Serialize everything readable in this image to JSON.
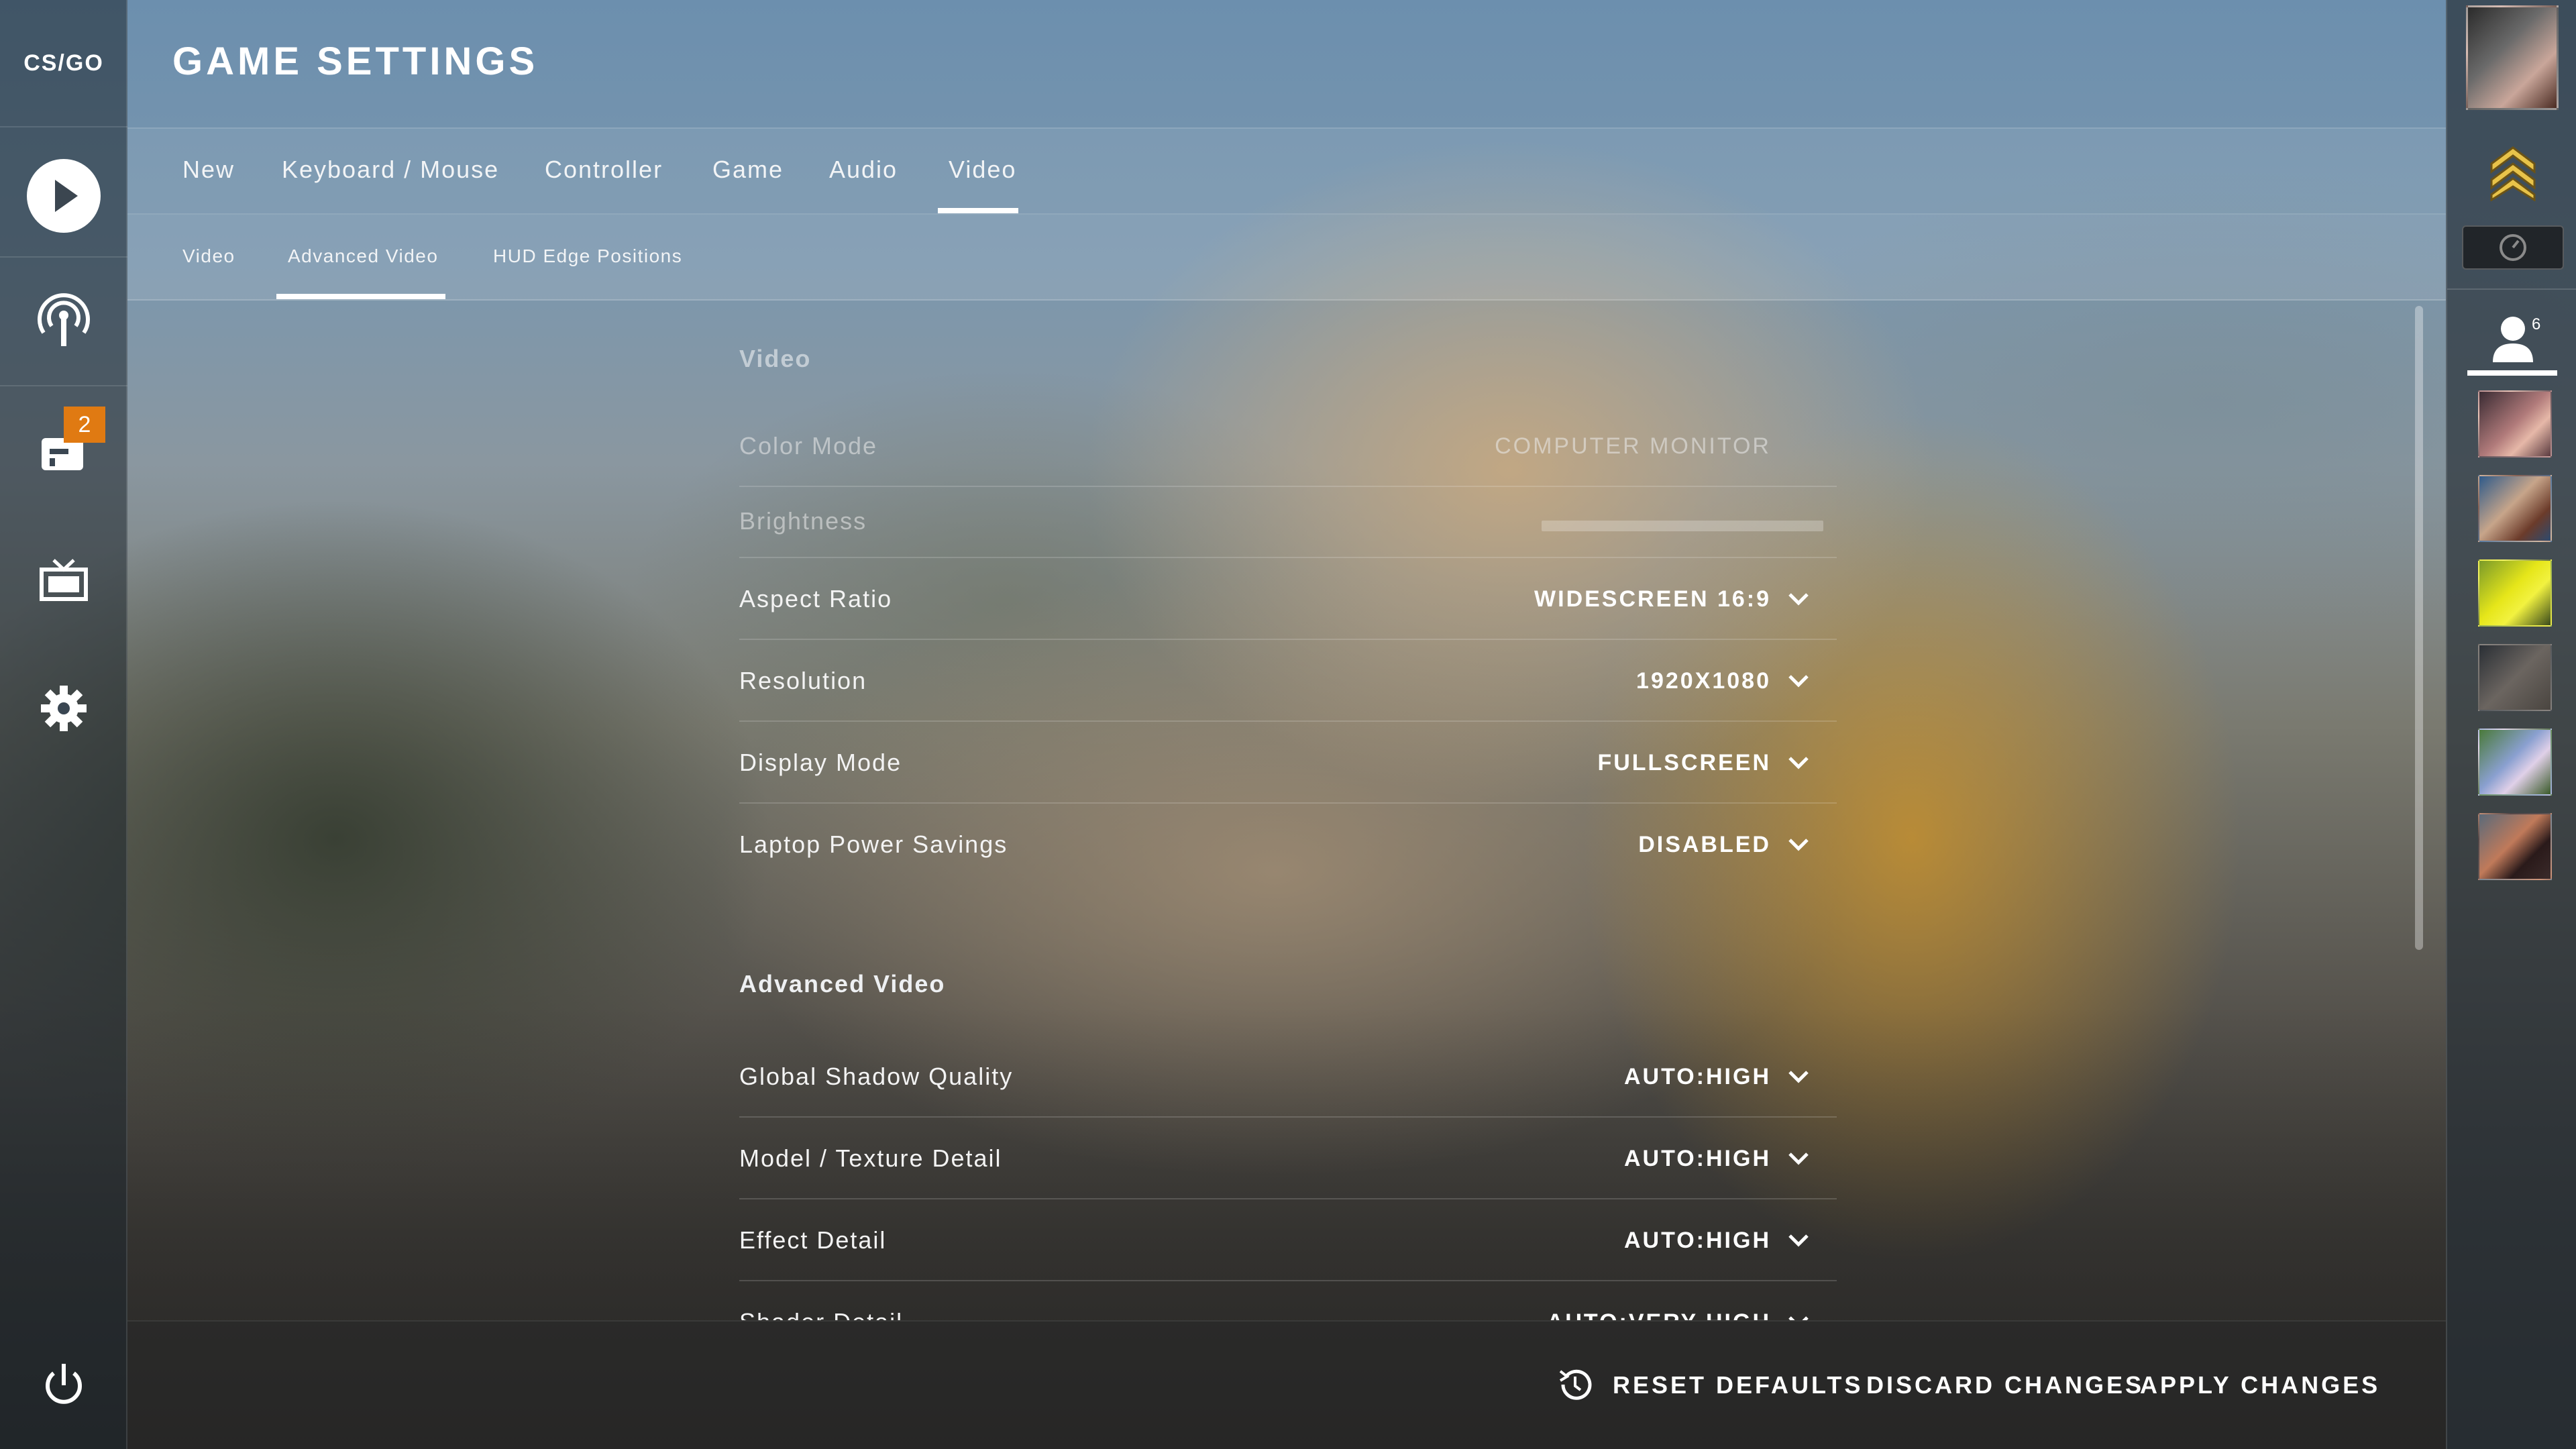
{
  "app": {
    "logo_text": "CS/GO",
    "page_title": "GAME SETTINGS"
  },
  "left_sidebar": {
    "items": [
      {
        "name": "play",
        "icon": "play-icon"
      },
      {
        "name": "watch-live",
        "icon": "broadcast-icon"
      },
      {
        "name": "inventory",
        "icon": "inventory-icon",
        "badge": "2"
      },
      {
        "name": "tv",
        "icon": "tv-icon"
      },
      {
        "name": "settings",
        "icon": "gear-icon"
      },
      {
        "name": "quit",
        "icon": "power-icon"
      }
    ]
  },
  "tabs": {
    "items": [
      "New",
      "Keyboard / Mouse",
      "Controller",
      "Game",
      "Audio",
      "Video"
    ],
    "active": "Video"
  },
  "subtabs": {
    "items": [
      "Video",
      "Advanced Video",
      "HUD Edge Positions"
    ],
    "active": "Advanced Video"
  },
  "sections": {
    "video": {
      "title": "Video",
      "rows": {
        "color_mode": {
          "label": "Color Mode",
          "value": "COMPUTER MONITOR"
        },
        "brightness": {
          "label": "Brightness"
        },
        "aspect_ratio": {
          "label": "Aspect Ratio",
          "value": "WIDESCREEN 16:9"
        },
        "resolution": {
          "label": "Resolution",
          "value": "1920X1080"
        },
        "display_mode": {
          "label": "Display Mode",
          "value": "FULLSCREEN"
        },
        "laptop_power": {
          "label": "Laptop Power Savings",
          "value": "DISABLED"
        }
      }
    },
    "advanced": {
      "title": "Advanced Video",
      "rows": {
        "shadow": {
          "label": "Global Shadow Quality",
          "value": "AUTO:HIGH"
        },
        "texture": {
          "label": "Model / Texture Detail",
          "value": "AUTO:HIGH"
        },
        "effect": {
          "label": "Effect Detail",
          "value": "AUTO:HIGH"
        },
        "shader": {
          "label": "Shader Detail",
          "value": "AUTO:VERY HIGH"
        }
      }
    }
  },
  "footer": {
    "reset": "RESET DEFAULTS",
    "discard": "DISCARD CHANGES",
    "apply": "APPLY CHANGES"
  },
  "right_sidebar": {
    "friends_count": "6",
    "friends": [
      "friend-1",
      "friend-2",
      "friend-3",
      "friend-4",
      "friend-5",
      "friend-6"
    ]
  },
  "colors": {
    "accent": "#ffffff",
    "badge": "#e07a12"
  }
}
